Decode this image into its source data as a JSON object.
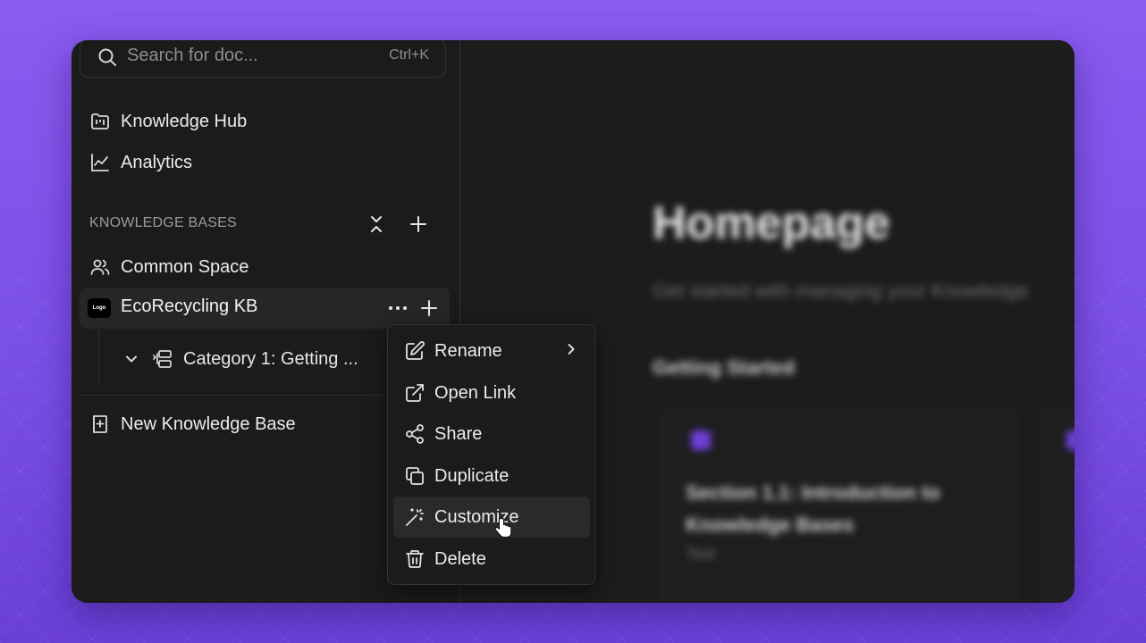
{
  "search": {
    "placeholder": "Search for doc...",
    "shortcut": "Ctrl+K"
  },
  "nav": [
    {
      "label": "Knowledge Hub",
      "icon": "folder-kanban-icon"
    },
    {
      "label": "Analytics",
      "icon": "line-chart-icon"
    }
  ],
  "knowledge_bases": {
    "heading": "KNOWLEDGE BASES",
    "items": [
      {
        "label": "Common Space",
        "icon": "users-icon"
      },
      {
        "label": "EcoRecycling KB",
        "logo_text": "Logo"
      }
    ],
    "category": {
      "label": "Category 1: Getting ..."
    },
    "new_label": "New Knowledge Base"
  },
  "main": {
    "title": "Homepage",
    "subtitle": "Get started with managing your Knowledge",
    "section": "Getting Started",
    "card_title_line1": "Section 1.1: Introduction to",
    "card_title_line2": "Knowledge Bases",
    "card_meta": "Text"
  },
  "context_menu": {
    "items": [
      {
        "label": "Rename",
        "icon": "pencil-square-icon",
        "submenu": true
      },
      {
        "label": "Open Link",
        "icon": "external-link-icon"
      },
      {
        "label": "Share",
        "icon": "share-icon"
      },
      {
        "label": "Duplicate",
        "icon": "copy-icon"
      },
      {
        "label": "Customize",
        "icon": "magic-wand-icon",
        "highlighted": true
      },
      {
        "label": "Delete",
        "icon": "trash-icon"
      }
    ]
  },
  "colors": {
    "background": "#8a5cf0",
    "panel": "#1b1b1c",
    "accent": "#7c3aed"
  }
}
